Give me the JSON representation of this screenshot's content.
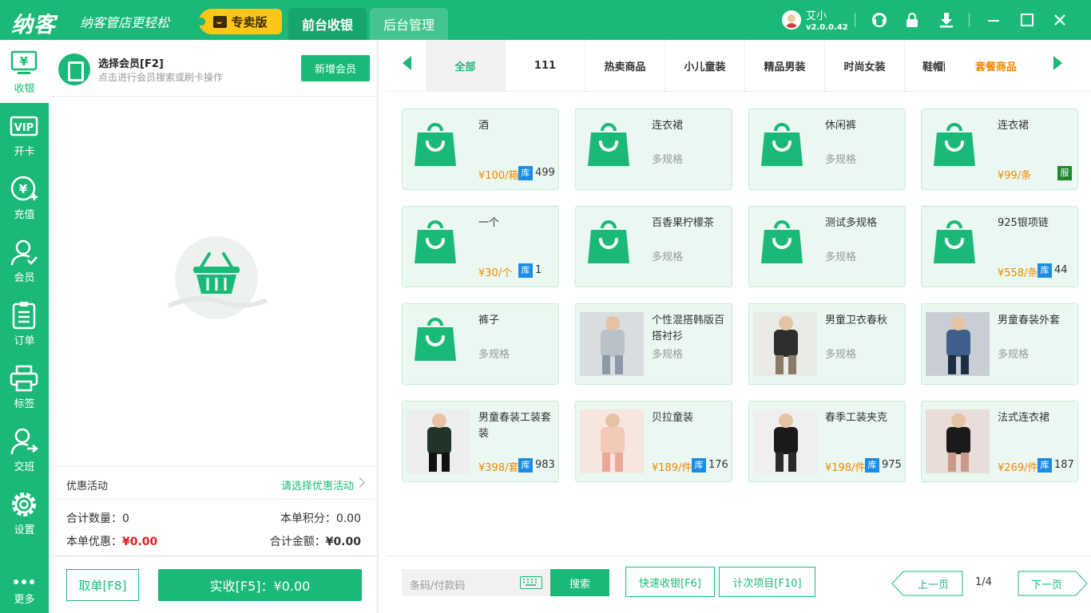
{
  "app": {
    "brand": "纳客",
    "slogan": "纳客管店更轻松",
    "edition": "专卖版",
    "tabs": [
      {
        "label": "前台收银"
      },
      {
        "label": "后台管理"
      }
    ],
    "user": {
      "name": "艾小",
      "version": "v2.0.0.42"
    },
    "accent": "#1bb978",
    "price_color": "#f08a00"
  },
  "sidebar": {
    "items": [
      {
        "label": "收银",
        "icon": "cashier-icon"
      },
      {
        "label": "开卡",
        "icon": "vip-card-icon"
      },
      {
        "label": "充值",
        "icon": "recharge-icon"
      },
      {
        "label": "会员",
        "icon": "member-icon"
      },
      {
        "label": "订单",
        "icon": "order-icon"
      },
      {
        "label": "标签",
        "icon": "printer-icon"
      },
      {
        "label": "交班",
        "icon": "shift-icon"
      },
      {
        "label": "设置",
        "icon": "gear-icon"
      },
      {
        "label": "更多",
        "icon": "more-icon"
      }
    ]
  },
  "member": {
    "title": "选择会员[F2]",
    "hint": "点击进行会员搜索或刷卡操作",
    "new_button": "新增会员"
  },
  "promo": {
    "label": "优惠活动",
    "action": "请选择优惠活动"
  },
  "summary": {
    "qty_label": "合计数量：",
    "qty": "0",
    "points_label": "本单积分：",
    "points": "0.00",
    "discount_label": "本单优惠：",
    "discount": "¥0.00",
    "total_label": "合计金额：",
    "total": "¥0.00"
  },
  "footer": {
    "cancel": "取单[F8]",
    "pay": "实收[F5]：¥0.00"
  },
  "categories": [
    "全部",
    "111",
    "热卖商品",
    "小儿童装",
    "精品男装",
    "时尚女装",
    "鞋帽配",
    "套餐商品"
  ],
  "products": [
    {
      "name": "酒",
      "price": "¥100/箱",
      "stock_badge": "库",
      "stock": "499"
    },
    {
      "name": "连衣裙",
      "spec": "多规格"
    },
    {
      "name": "休闲裤",
      "spec": "多规格"
    },
    {
      "name": "连衣裙",
      "price": "¥99/条",
      "stock_badge": "服"
    },
    {
      "name": "一个",
      "price": "¥30/个",
      "stock_badge": "库",
      "stock": "1"
    },
    {
      "name": "百香果柠檬茶",
      "spec": "多规格"
    },
    {
      "name": "测试多规格",
      "spec": "多规格"
    },
    {
      "name": "925银项链",
      "price": "¥558/条",
      "stock_badge": "库",
      "stock": "44"
    },
    {
      "name": "裤子",
      "spec": "多规格"
    },
    {
      "name": "个性混搭韩版百搭衬衫",
      "spec": "多规格"
    },
    {
      "name": "男童卫衣春秋",
      "spec": "多规格"
    },
    {
      "name": "男童春装外套",
      "spec": "多规格"
    },
    {
      "name": "男童春装工装套装",
      "price": "¥398/套",
      "stock_badge": "库",
      "stock": "983"
    },
    {
      "name": "贝拉童装",
      "price": "¥189/件",
      "stock_badge": "库",
      "stock": "176"
    },
    {
      "name": "春季工装夹克",
      "price": "¥198/件",
      "stock_badge": "库",
      "stock": "975"
    },
    {
      "name": "法式连衣裙",
      "price": "¥269/件",
      "stock_badge": "库",
      "stock": "187"
    }
  ],
  "bottom": {
    "search_placeholder": "条码/付款码",
    "search": "搜索",
    "quick": "快速收银[F6]",
    "count_items": "计次项目[F10]",
    "prev": "上一页",
    "page": "1/4",
    "next": "下一页"
  }
}
